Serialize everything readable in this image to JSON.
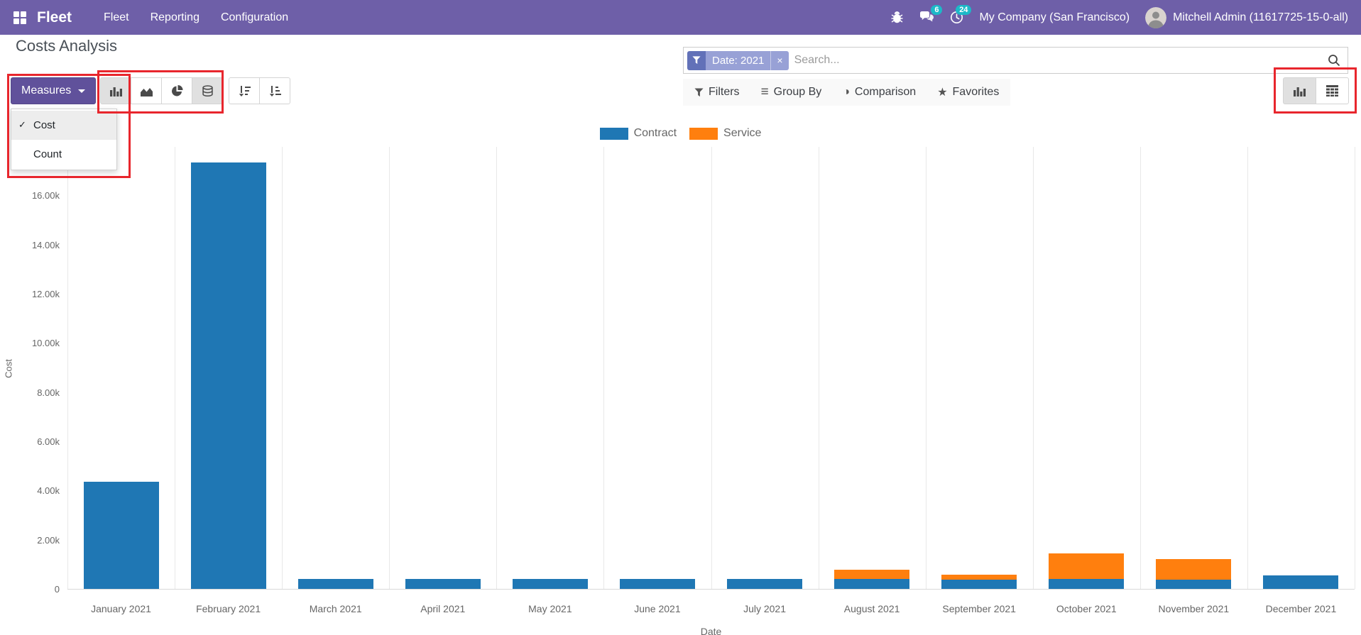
{
  "nav": {
    "brand": "Fleet",
    "menus": [
      "Fleet",
      "Reporting",
      "Configuration"
    ],
    "systray": {
      "chat_badge": "6",
      "activity_badge": "24",
      "company": "My Company (San Francisco)",
      "user": "Mitchell Admin (11617725-15-0-all)"
    }
  },
  "page": {
    "title": "Costs Analysis"
  },
  "toolbar": {
    "measures_label": "Measures",
    "measures_items": [
      {
        "label": "Cost",
        "checked": true
      },
      {
        "label": "Count",
        "checked": false
      }
    ]
  },
  "search": {
    "facet_label": "Date: 2021",
    "placeholder": "Search...",
    "buttons": {
      "filters": "Filters",
      "group_by": "Group By",
      "comparison": "Comparison",
      "favorites": "Favorites"
    }
  },
  "icons": {
    "check": "✓",
    "facet_remove": "×",
    "group_by": "≡",
    "comparison": "◑",
    "favorites": "★"
  },
  "colors": {
    "navbar": "#6e5fa8",
    "badge": "#1cb9c8",
    "annotation": "#e8262d"
  },
  "chart_data": {
    "type": "bar",
    "stacked": true,
    "title": "",
    "categories": [
      "January 2021",
      "February 2021",
      "March 2021",
      "April 2021",
      "May 2021",
      "June 2021",
      "July 2021",
      "August 2021",
      "September 2021",
      "October 2021",
      "November 2021",
      "December 2021"
    ],
    "series": [
      {
        "name": "Contract",
        "color": "#1f77b4",
        "values": [
          4350,
          17350,
          400,
          400,
          400,
          400,
          400,
          400,
          380,
          400,
          380,
          550
        ]
      },
      {
        "name": "Service",
        "color": "#ff7f0e",
        "values": [
          0,
          0,
          0,
          0,
          0,
          0,
          0,
          380,
          200,
          1050,
          830,
          0
        ]
      }
    ],
    "xlabel": "Date",
    "ylabel": "Cost",
    "yticks": [
      0,
      2000,
      4000,
      6000,
      8000,
      10000,
      12000,
      14000,
      16000
    ],
    "ytick_labels": [
      "0",
      "2.00k",
      "4.00k",
      "6.00k",
      "8.00k",
      "10.00k",
      "12.00k",
      "14.00k",
      "16.00k"
    ],
    "ylim": [
      0,
      18000
    ],
    "legend_position": "top",
    "grid": "vertical"
  }
}
